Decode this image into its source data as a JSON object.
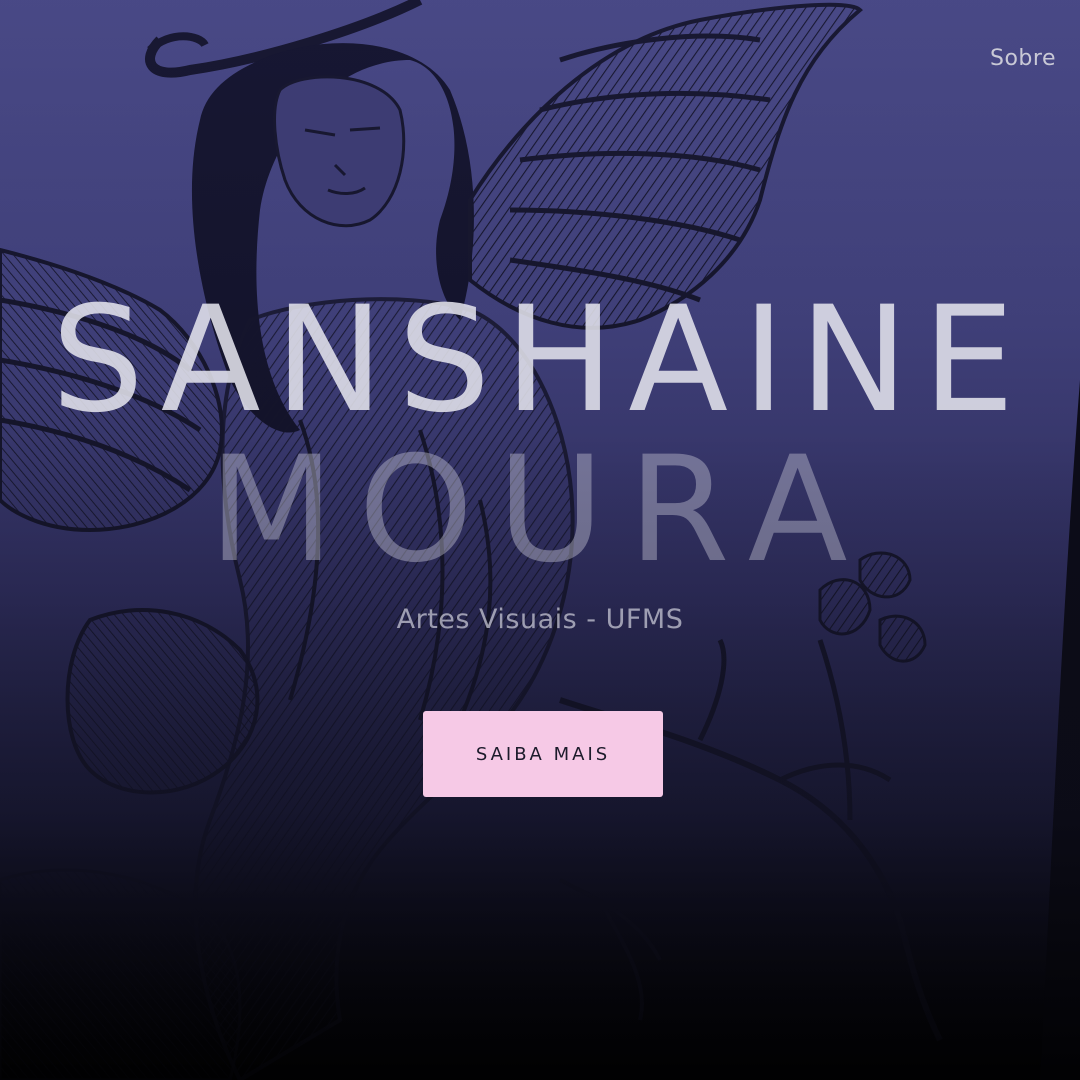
{
  "nav": {
    "about_label": "Sobre"
  },
  "hero": {
    "first_name": "SANSHAINE",
    "last_name": "MOURA",
    "subtitle": "Artes Visuais - UFMS",
    "cta_label": "SAIBA MAIS"
  },
  "colors": {
    "background": "#3f3f78",
    "button": "#f6c9e6",
    "button_text": "#1c1b2b",
    "title": "#e2e2ec"
  }
}
